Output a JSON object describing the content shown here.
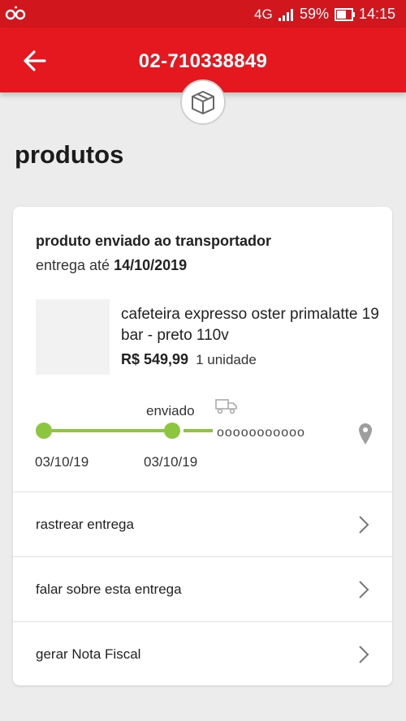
{
  "status_bar": {
    "network": "4G",
    "battery_percent": "59%",
    "time": "14:15"
  },
  "header": {
    "title": "02-710338849",
    "accent_color": "#e5171f"
  },
  "section": {
    "title": "produtos"
  },
  "order": {
    "status": "produto enviado ao transportador",
    "delivery_prefix": "entrega até",
    "delivery_date": "14/10/2019"
  },
  "product": {
    "name": "cafeteira expresso oster primalatte 19 bar - preto 110v",
    "price": "R$ 549,99",
    "quantity": "1 unidade"
  },
  "tracking": {
    "current_step_label": "enviado",
    "pending_steps": "ooooooooooo",
    "date_first": "03/10/19",
    "date_second": "03/10/19",
    "progress_color": "#8cc63f"
  },
  "actions": [
    {
      "label": "rastrear entrega"
    },
    {
      "label": "falar sobre esta entrega"
    },
    {
      "label": "gerar Nota Fiscal"
    }
  ]
}
